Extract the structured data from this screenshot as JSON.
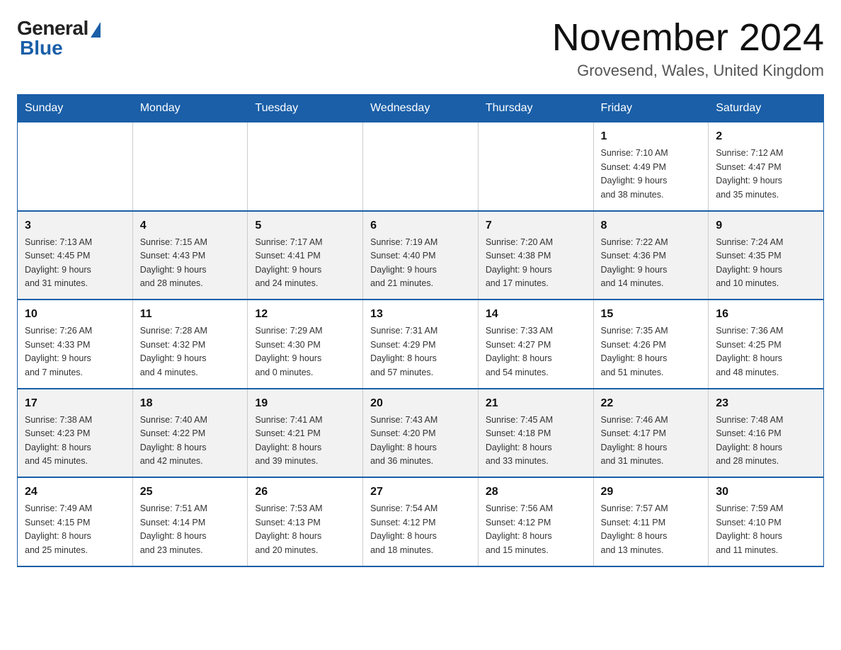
{
  "header": {
    "logo_general": "General",
    "logo_blue": "Blue",
    "month_title": "November 2024",
    "location": "Grovesend, Wales, United Kingdom"
  },
  "weekdays": [
    "Sunday",
    "Monday",
    "Tuesday",
    "Wednesday",
    "Thursday",
    "Friday",
    "Saturday"
  ],
  "weeks": [
    [
      {
        "day": "",
        "info": ""
      },
      {
        "day": "",
        "info": ""
      },
      {
        "day": "",
        "info": ""
      },
      {
        "day": "",
        "info": ""
      },
      {
        "day": "",
        "info": ""
      },
      {
        "day": "1",
        "info": "Sunrise: 7:10 AM\nSunset: 4:49 PM\nDaylight: 9 hours\nand 38 minutes."
      },
      {
        "day": "2",
        "info": "Sunrise: 7:12 AM\nSunset: 4:47 PM\nDaylight: 9 hours\nand 35 minutes."
      }
    ],
    [
      {
        "day": "3",
        "info": "Sunrise: 7:13 AM\nSunset: 4:45 PM\nDaylight: 9 hours\nand 31 minutes."
      },
      {
        "day": "4",
        "info": "Sunrise: 7:15 AM\nSunset: 4:43 PM\nDaylight: 9 hours\nand 28 minutes."
      },
      {
        "day": "5",
        "info": "Sunrise: 7:17 AM\nSunset: 4:41 PM\nDaylight: 9 hours\nand 24 minutes."
      },
      {
        "day": "6",
        "info": "Sunrise: 7:19 AM\nSunset: 4:40 PM\nDaylight: 9 hours\nand 21 minutes."
      },
      {
        "day": "7",
        "info": "Sunrise: 7:20 AM\nSunset: 4:38 PM\nDaylight: 9 hours\nand 17 minutes."
      },
      {
        "day": "8",
        "info": "Sunrise: 7:22 AM\nSunset: 4:36 PM\nDaylight: 9 hours\nand 14 minutes."
      },
      {
        "day": "9",
        "info": "Sunrise: 7:24 AM\nSunset: 4:35 PM\nDaylight: 9 hours\nand 10 minutes."
      }
    ],
    [
      {
        "day": "10",
        "info": "Sunrise: 7:26 AM\nSunset: 4:33 PM\nDaylight: 9 hours\nand 7 minutes."
      },
      {
        "day": "11",
        "info": "Sunrise: 7:28 AM\nSunset: 4:32 PM\nDaylight: 9 hours\nand 4 minutes."
      },
      {
        "day": "12",
        "info": "Sunrise: 7:29 AM\nSunset: 4:30 PM\nDaylight: 9 hours\nand 0 minutes."
      },
      {
        "day": "13",
        "info": "Sunrise: 7:31 AM\nSunset: 4:29 PM\nDaylight: 8 hours\nand 57 minutes."
      },
      {
        "day": "14",
        "info": "Sunrise: 7:33 AM\nSunset: 4:27 PM\nDaylight: 8 hours\nand 54 minutes."
      },
      {
        "day": "15",
        "info": "Sunrise: 7:35 AM\nSunset: 4:26 PM\nDaylight: 8 hours\nand 51 minutes."
      },
      {
        "day": "16",
        "info": "Sunrise: 7:36 AM\nSunset: 4:25 PM\nDaylight: 8 hours\nand 48 minutes."
      }
    ],
    [
      {
        "day": "17",
        "info": "Sunrise: 7:38 AM\nSunset: 4:23 PM\nDaylight: 8 hours\nand 45 minutes."
      },
      {
        "day": "18",
        "info": "Sunrise: 7:40 AM\nSunset: 4:22 PM\nDaylight: 8 hours\nand 42 minutes."
      },
      {
        "day": "19",
        "info": "Sunrise: 7:41 AM\nSunset: 4:21 PM\nDaylight: 8 hours\nand 39 minutes."
      },
      {
        "day": "20",
        "info": "Sunrise: 7:43 AM\nSunset: 4:20 PM\nDaylight: 8 hours\nand 36 minutes."
      },
      {
        "day": "21",
        "info": "Sunrise: 7:45 AM\nSunset: 4:18 PM\nDaylight: 8 hours\nand 33 minutes."
      },
      {
        "day": "22",
        "info": "Sunrise: 7:46 AM\nSunset: 4:17 PM\nDaylight: 8 hours\nand 31 minutes."
      },
      {
        "day": "23",
        "info": "Sunrise: 7:48 AM\nSunset: 4:16 PM\nDaylight: 8 hours\nand 28 minutes."
      }
    ],
    [
      {
        "day": "24",
        "info": "Sunrise: 7:49 AM\nSunset: 4:15 PM\nDaylight: 8 hours\nand 25 minutes."
      },
      {
        "day": "25",
        "info": "Sunrise: 7:51 AM\nSunset: 4:14 PM\nDaylight: 8 hours\nand 23 minutes."
      },
      {
        "day": "26",
        "info": "Sunrise: 7:53 AM\nSunset: 4:13 PM\nDaylight: 8 hours\nand 20 minutes."
      },
      {
        "day": "27",
        "info": "Sunrise: 7:54 AM\nSunset: 4:12 PM\nDaylight: 8 hours\nand 18 minutes."
      },
      {
        "day": "28",
        "info": "Sunrise: 7:56 AM\nSunset: 4:12 PM\nDaylight: 8 hours\nand 15 minutes."
      },
      {
        "day": "29",
        "info": "Sunrise: 7:57 AM\nSunset: 4:11 PM\nDaylight: 8 hours\nand 13 minutes."
      },
      {
        "day": "30",
        "info": "Sunrise: 7:59 AM\nSunset: 4:10 PM\nDaylight: 8 hours\nand 11 minutes."
      }
    ]
  ]
}
